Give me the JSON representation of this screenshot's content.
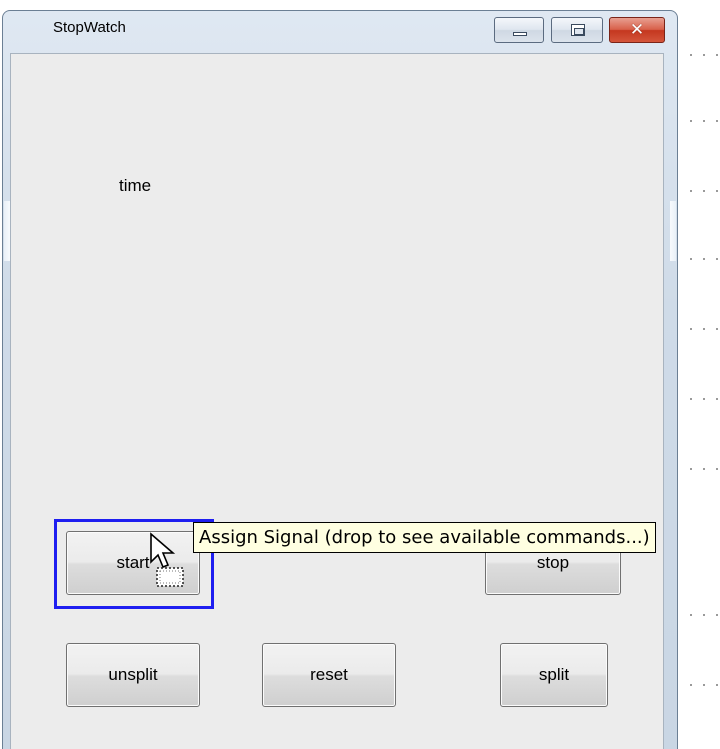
{
  "window": {
    "title": "StopWatch"
  },
  "labels": {
    "time": "time"
  },
  "buttons": {
    "start": "start",
    "stop": "stop",
    "unsplit": "unsplit",
    "reset": "reset",
    "split": "split"
  },
  "tooltip": {
    "text": "Assign Signal (drop to see available commands...)"
  },
  "icons": {
    "minimize": "minimize-icon",
    "maximize": "maximize-icon",
    "close": "close-icon",
    "cursor": "arrow-cursor-with-drop-icon"
  },
  "colors": {
    "selection": "#1e1ef0",
    "tooltip_bg": "#ffffe1",
    "close_button": "#c4371f"
  }
}
